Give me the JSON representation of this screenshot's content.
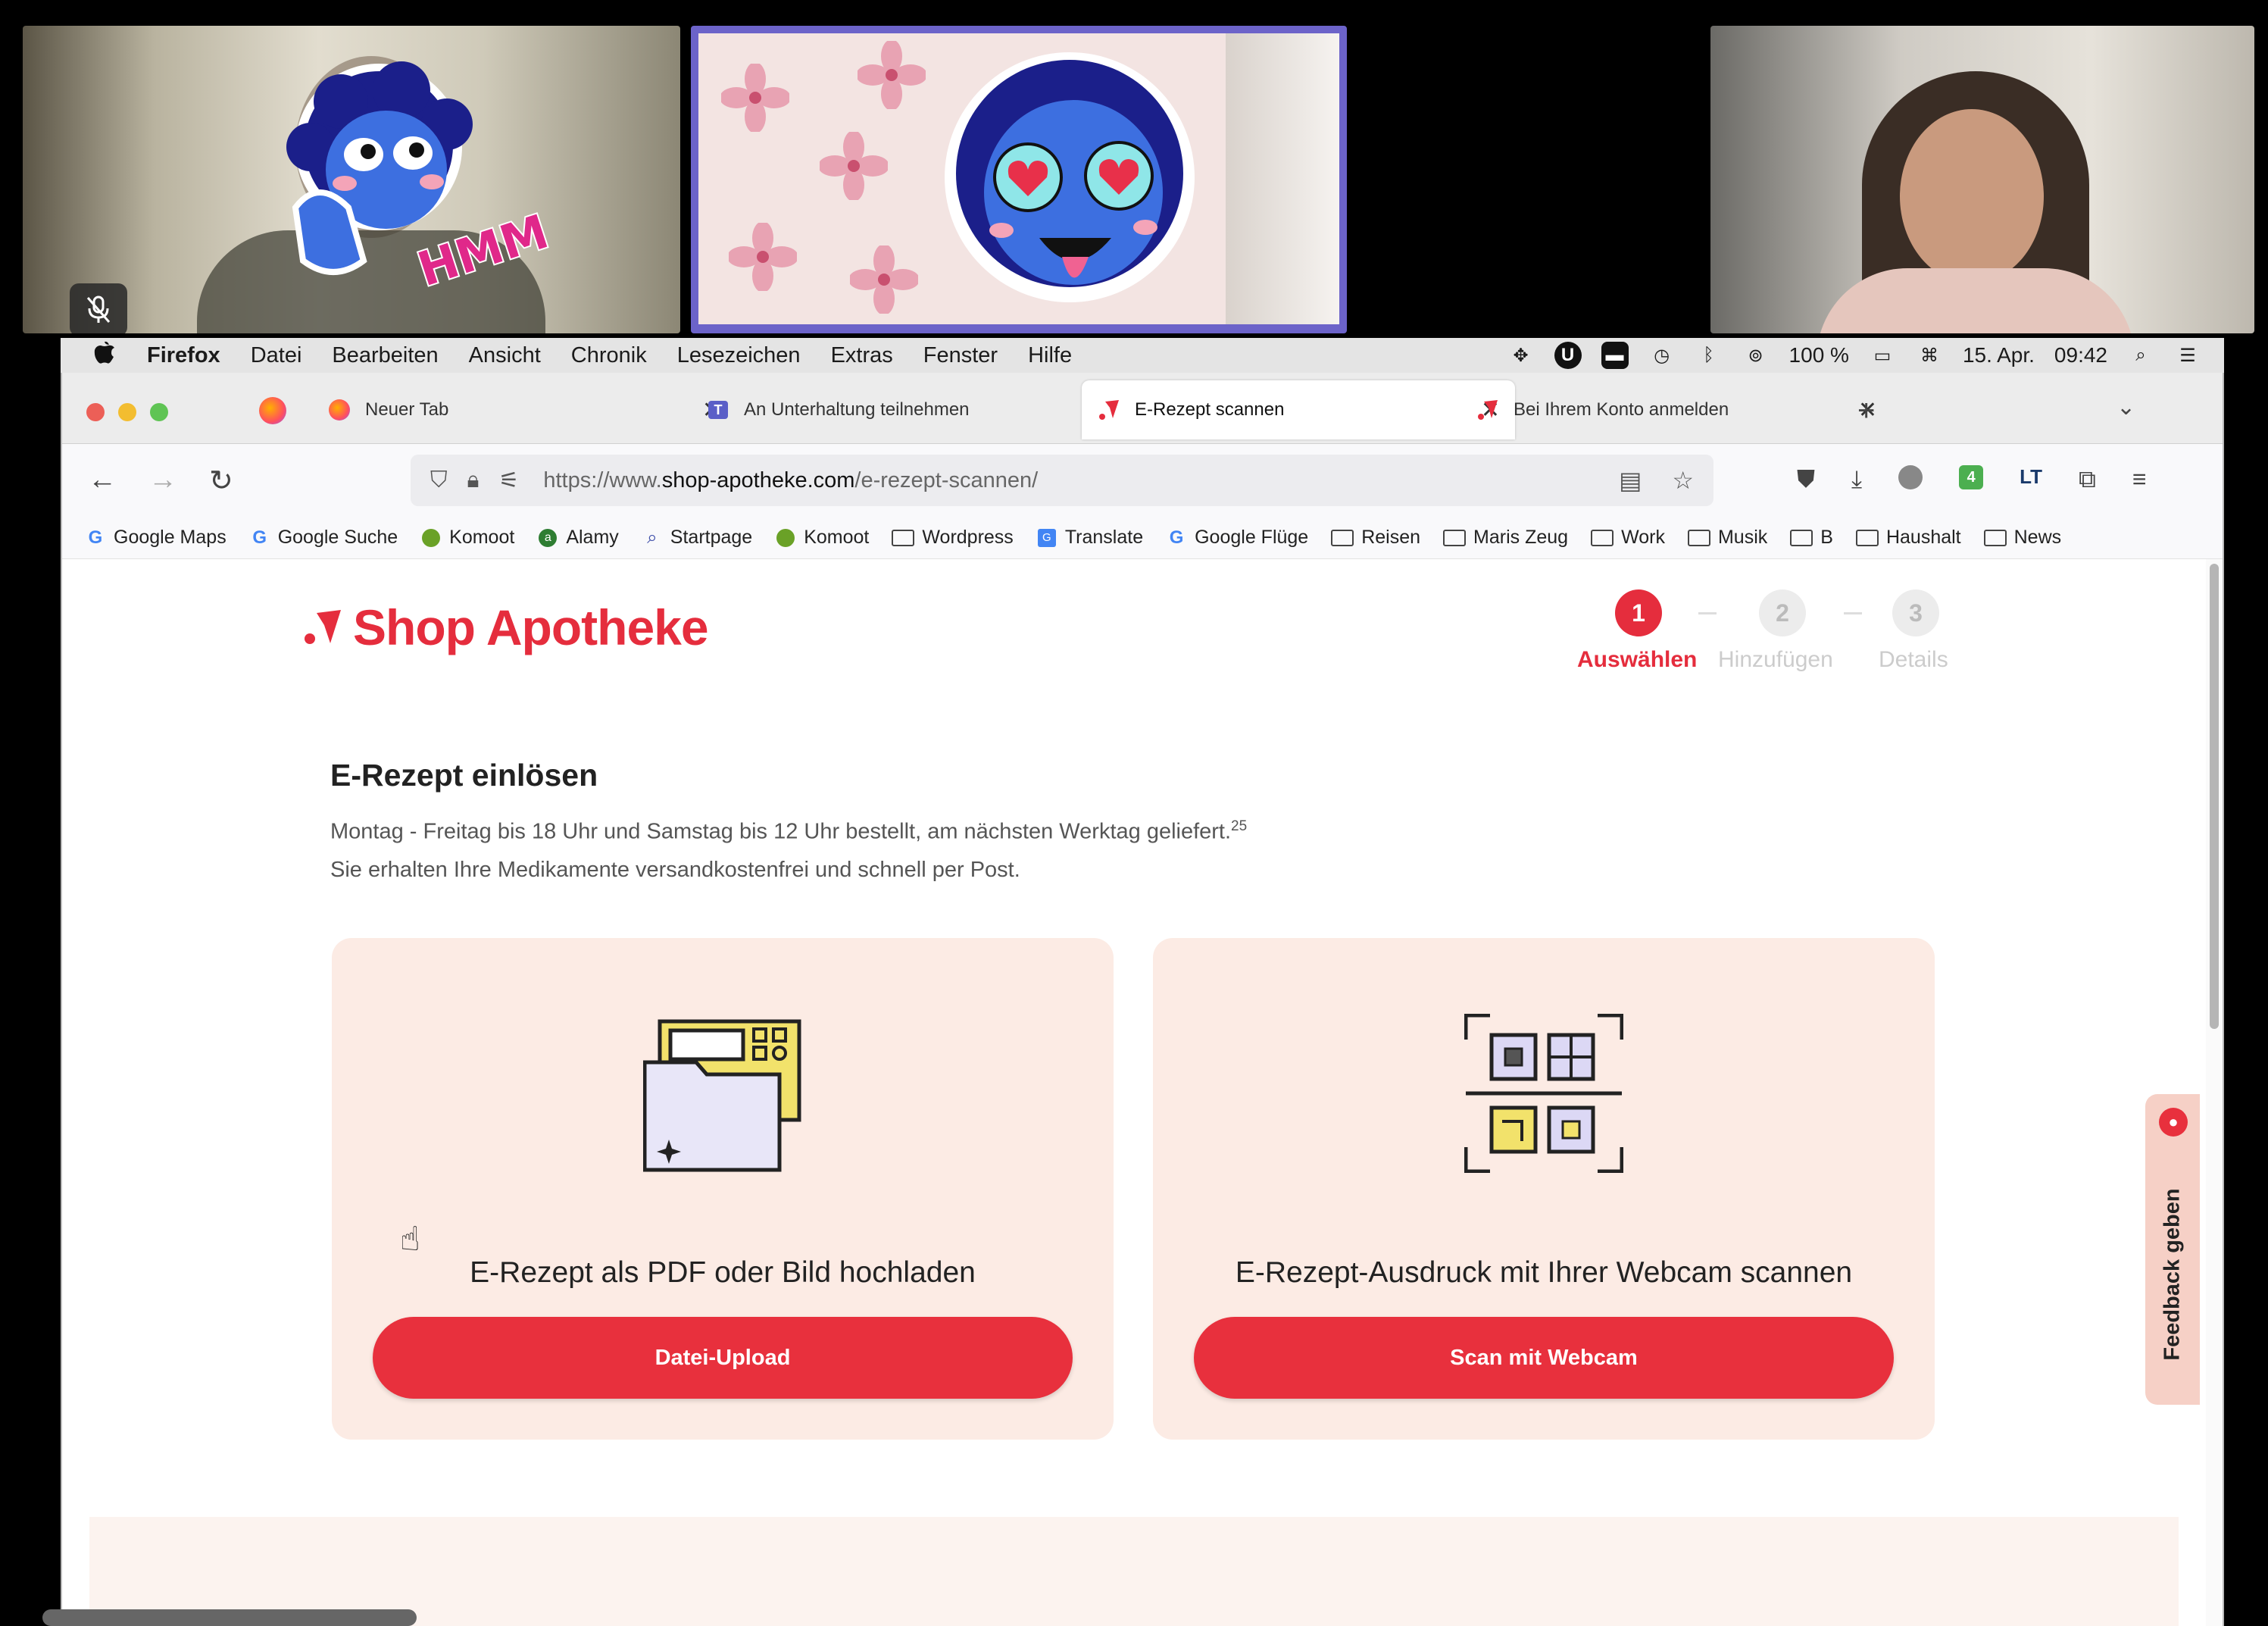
{
  "video_call": {
    "tiles": [
      {
        "sticker_text": "HMM",
        "muted": true
      },
      {
        "sticker": "heart-eyes-emoji"
      },
      {
        "participant": "woman-looking-down"
      }
    ]
  },
  "menubar": {
    "app_name": "Firefox",
    "items": [
      "Datei",
      "Bearbeiten",
      "Ansicht",
      "Chronik",
      "Lesezeichen",
      "Extras",
      "Fenster",
      "Hilfe"
    ],
    "battery": "100 %",
    "date": "15. Apr.",
    "time": "09:42"
  },
  "tabs": [
    {
      "label": "Neuer Tab",
      "icon": "firefox-icon"
    },
    {
      "label": "An Unterhaltung teilnehmen",
      "icon": "teams-icon"
    },
    {
      "label": "E-Rezept scannen",
      "icon": "shop-apotheke-icon",
      "active": true
    },
    {
      "label": "Bei Ihrem Konto anmelden",
      "icon": "shop-apotheke-icon"
    }
  ],
  "url": {
    "prefix": "https://www.",
    "domain": "shop-apotheke.com",
    "path": "/e-rezept-scannen/"
  },
  "extensions": {
    "badge_count": "4"
  },
  "bookmarks": [
    {
      "label": "Google Maps",
      "type": "google"
    },
    {
      "label": "Google Suche",
      "type": "google"
    },
    {
      "label": "Komoot",
      "type": "komoot"
    },
    {
      "label": "Alamy",
      "type": "alamy"
    },
    {
      "label": "Startpage",
      "type": "search"
    },
    {
      "label": "Komoot",
      "type": "komoot"
    },
    {
      "label": "Wordpress",
      "type": "folder"
    },
    {
      "label": "Translate",
      "type": "translate"
    },
    {
      "label": "Google Flüge",
      "type": "google"
    },
    {
      "label": "Reisen",
      "type": "folder"
    },
    {
      "label": "Maris Zeug",
      "type": "folder"
    },
    {
      "label": "Work",
      "type": "folder"
    },
    {
      "label": "Musik",
      "type": "folder"
    },
    {
      "label": "B",
      "type": "folder"
    },
    {
      "label": "Haushalt",
      "type": "folder"
    },
    {
      "label": "News",
      "type": "folder"
    }
  ],
  "site": {
    "logo": "Shop Apotheke",
    "steps": [
      {
        "number": "1",
        "label": "Auswählen",
        "active": true
      },
      {
        "number": "2",
        "label": "Hinzufügen",
        "active": false
      },
      {
        "number": "3",
        "label": "Details",
        "active": false
      }
    ],
    "heading": "E-Rezept einlösen",
    "subtext_line1": "Montag - Freitag bis 18 Uhr und Samstag bis 12 Uhr bestellt, am nächsten Werktag geliefert.",
    "subtext_footnote": "25",
    "subtext_line2": "Sie erhalten Ihre Medikamente versandkostenfrei und schnell per Post.",
    "cards": [
      {
        "title": "E-Rezept als PDF oder Bild hochladen",
        "button": "Datei-Upload",
        "icon": "folder-upload-icon"
      },
      {
        "title": "E-Rezept-Ausdruck mit Ihrer Webcam scannen",
        "button": "Scan mit Webcam",
        "icon": "qr-scan-icon"
      }
    ],
    "feedback": "Feedback geben",
    "brand_color": "#e52d3d",
    "card_bg": "#fcebe4"
  }
}
